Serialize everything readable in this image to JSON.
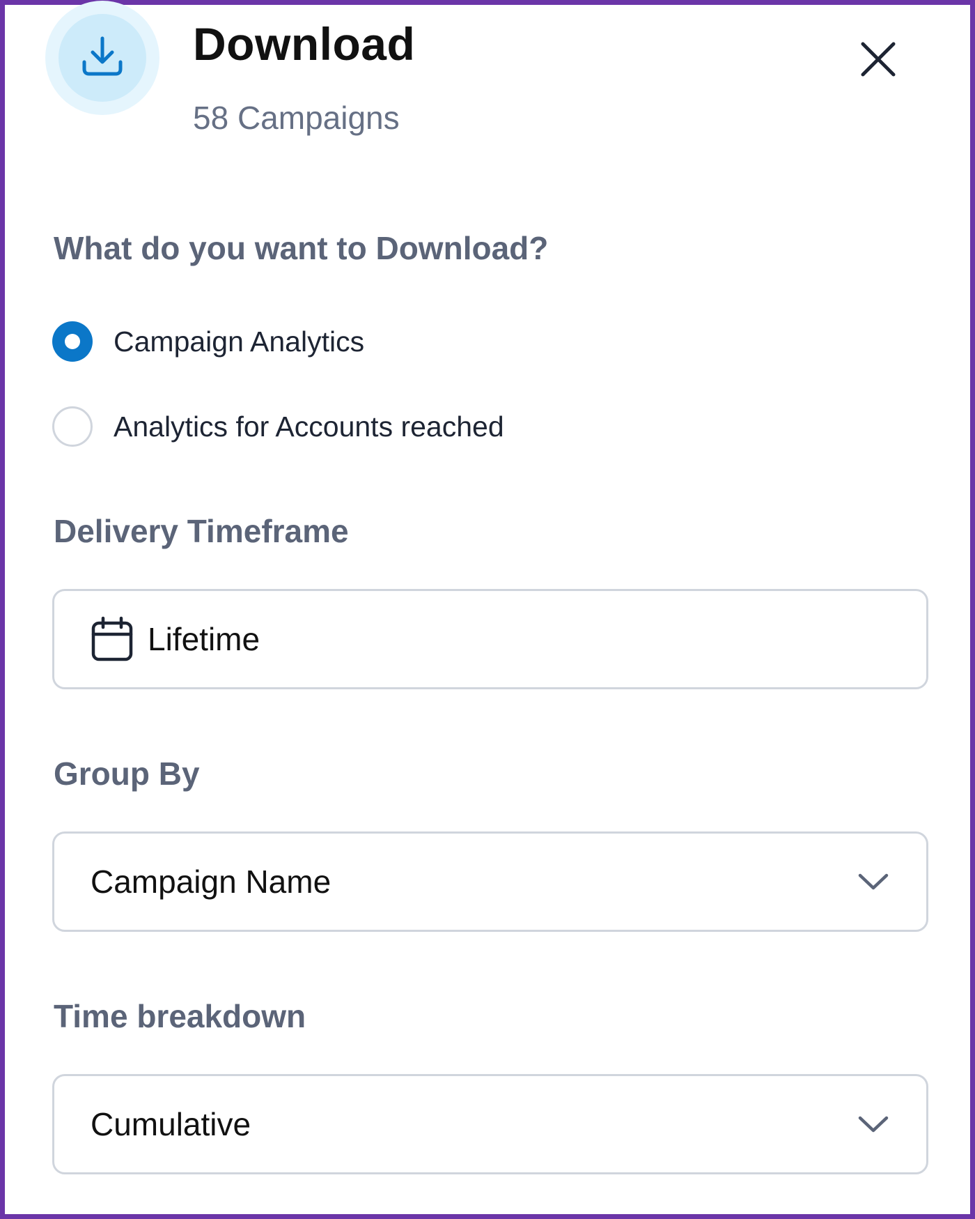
{
  "header": {
    "title": "Download",
    "subtitle": "58 Campaigns",
    "icon": "download-icon",
    "close_icon": "close-icon"
  },
  "question": {
    "label": "What do you want to Download?",
    "options": [
      {
        "label": "Campaign Analytics",
        "selected": true
      },
      {
        "label": "Analytics for Accounts reached",
        "selected": false
      }
    ]
  },
  "delivery_timeframe": {
    "label": "Delivery Timeframe",
    "value": "Lifetime",
    "icon": "calendar-icon"
  },
  "group_by": {
    "label": "Group By",
    "value": "Campaign Name",
    "icon": "chevron-down-icon"
  },
  "time_breakdown": {
    "label": "Time breakdown",
    "value": "Cumulative",
    "icon": "chevron-down-icon"
  },
  "colors": {
    "accent": "#0b77c8",
    "frame": "#6b35a8",
    "label_gray": "#5b6478",
    "icon_bg": "#cdebfa"
  }
}
